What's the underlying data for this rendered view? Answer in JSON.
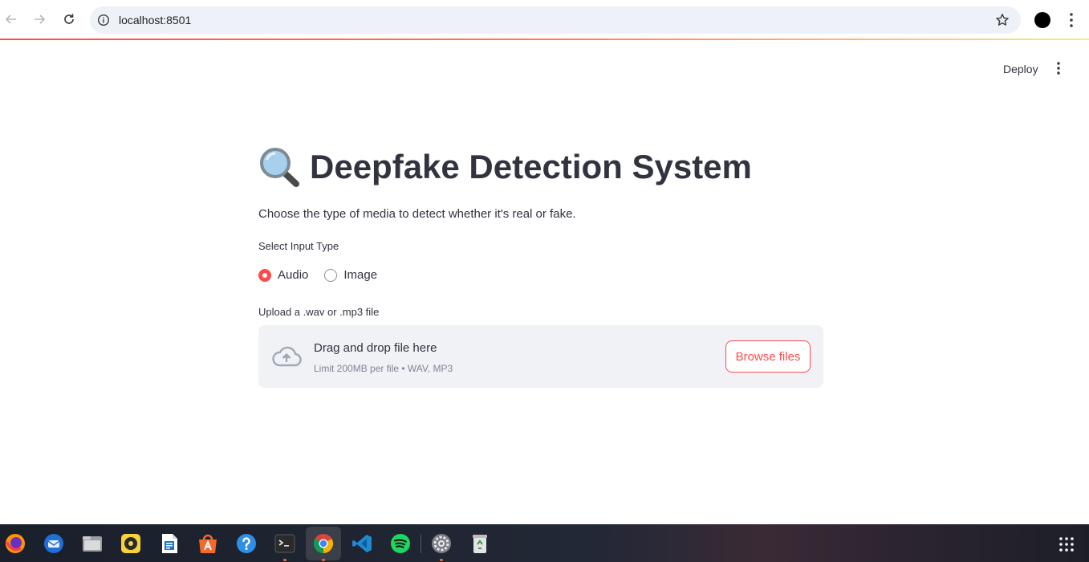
{
  "browser": {
    "url": "localhost:8501"
  },
  "header": {
    "deploy_label": "Deploy"
  },
  "main": {
    "title": "Deepfake Detection System",
    "subtitle": "Choose the type of media to detect whether it's real or fake.",
    "radio": {
      "label": "Select Input Type",
      "options": [
        {
          "label": "Audio",
          "selected": true
        },
        {
          "label": "Image",
          "selected": false
        }
      ]
    },
    "uploader": {
      "label": "Upload a .wav or .mp3 file",
      "title": "Drag and drop file here",
      "limit": "Limit 200MB per file • WAV, MP3",
      "button_label": "Browse files"
    }
  },
  "colors": {
    "accent": "#ff4b4b",
    "text": "#31333f",
    "muted": "#808495",
    "dropzone_bg": "#f0f2f6"
  },
  "taskbar": {
    "icons": [
      "firefox-icon",
      "thunderbird-icon",
      "files-icon",
      "rhythmbox-icon",
      "writer-icon",
      "app-center-icon",
      "help-icon",
      "terminal-icon",
      "chrome-icon",
      "vscode-icon",
      "spotify-icon",
      "settings-icon",
      "trash-icon",
      "show-apps-icon"
    ]
  }
}
